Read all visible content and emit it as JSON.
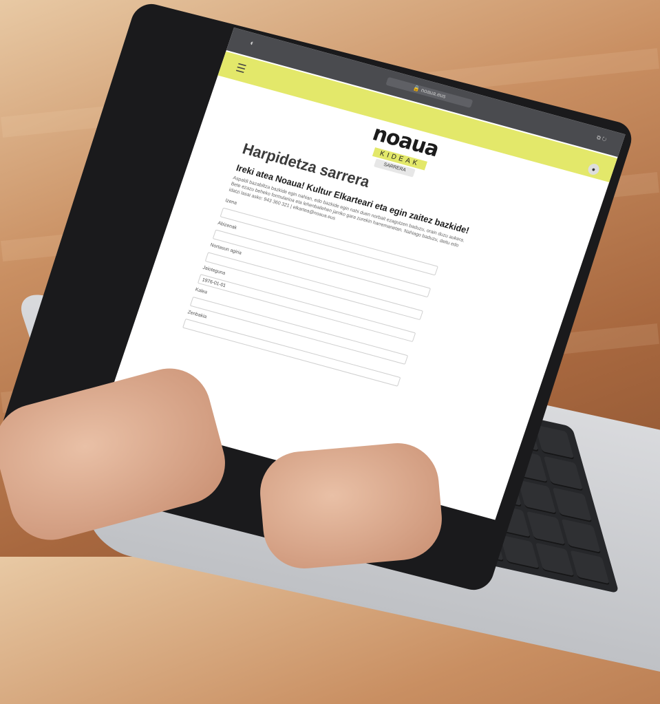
{
  "browser": {
    "theme_icon": "◐",
    "address": "🔒 noaua.eus",
    "tab_icons": "⧉ ↻"
  },
  "header": {
    "menu_icon": "☰",
    "user_icon": "●",
    "logo_main": "noaua",
    "logo_sub": "KIDEAK",
    "tab_label": "SARRERA"
  },
  "form": {
    "title": "Harpidetza sarrera",
    "subtitle": "Ireki atea Noaua! Kultur Elkarteari eta egin zaitez bazkide!",
    "intro": "Aspaldi bazabiltza bazkide egin nahian, edo bazkide egin nahi duen norbait ezagutzen baduzu, orain duzu aukera. Bete ezazu beheko formularioa eta lehenbailehen jarriko gara zurekin harremanetan. Nahiago baduzu, deitu edo idatzi lasai asko: 943 360 321 | elkartea@noaua.eus",
    "fields": [
      {
        "label": "Izena",
        "value": ""
      },
      {
        "label": "Abizenak",
        "value": ""
      },
      {
        "label": "Nortasun agiria",
        "value": ""
      },
      {
        "label": "Jaioteguna",
        "value": "1976-01-01"
      },
      {
        "label": "Kalea",
        "value": ""
      },
      {
        "label": "Zenbakia",
        "value": ""
      }
    ]
  },
  "colors": {
    "accent": "#e3e86a",
    "browser_bar": "#4a4b4f"
  }
}
